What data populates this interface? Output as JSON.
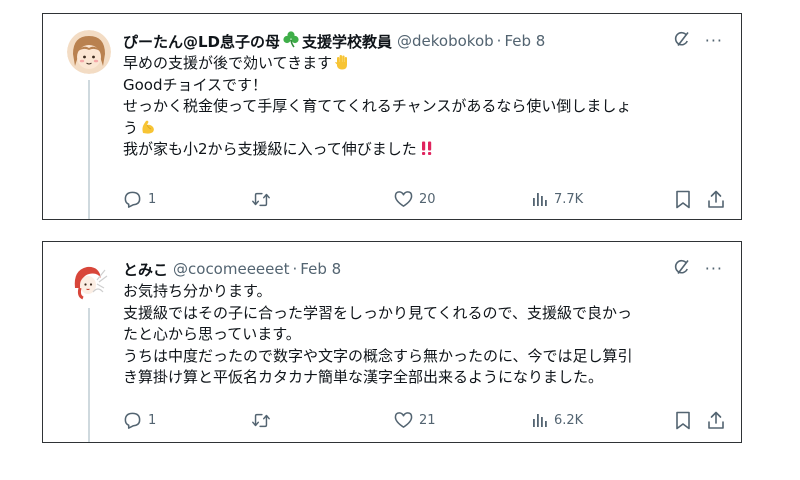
{
  "posts": [
    {
      "display_name": "ぴーたん@LD息子の母",
      "display_name_suffix": "支援学校教員",
      "handle": "@dekobokob",
      "separator": "·",
      "date": "Feb 8",
      "lines": [
        "早めの支援が後で効いてきます",
        "Goodチョイスです！",
        "せっかく税金使って手厚く育ててくれるチャンスがあるなら使い倒しましょ",
        "う",
        "我が家も小2から支援級に入って伸びました"
      ],
      "reply_count": "1",
      "retweet_count": "",
      "like_count": "20",
      "view_count": "7.7K"
    },
    {
      "display_name": "とみこ",
      "handle": "@cocomeeeeet",
      "separator": "·",
      "date": "Feb 8",
      "lines": [
        "お気持ち分かります。",
        "支援級ではその子に合った学習をしっかり見てくれるので、支援級で良かっ",
        "たと心から思っています。",
        "うちは中度だったので数字や文字の概念すら無かったのに、今では足し算引",
        "き算掛け算と平仮名カタカナ簡単な漢字全部出来るようになりました。"
      ],
      "reply_count": "1",
      "retweet_count": "",
      "like_count": "21",
      "view_count": "6.2K"
    }
  ],
  "more_label": "···",
  "icons": {
    "reply": "reply-icon",
    "retweet": "retweet-icon",
    "like": "heart-icon",
    "views": "views-icon",
    "bookmark": "bookmark-icon",
    "share": "share-icon",
    "grok": "grok-icon",
    "emoji_1": "raised-hand-emoji",
    "emoji_2": "flexed-biceps-emoji",
    "emoji_3": "double-exclamation-emoji",
    "name_emoji": "shamrock-emoji"
  },
  "colors": {
    "text": "#0f1419",
    "secondary": "#536471",
    "border": "#2f3336",
    "thread_line": "#cfd9de",
    "exclaim": "#e0245e",
    "emoji_yellow": "#f7c434",
    "shamrock": "#3fae49"
  }
}
